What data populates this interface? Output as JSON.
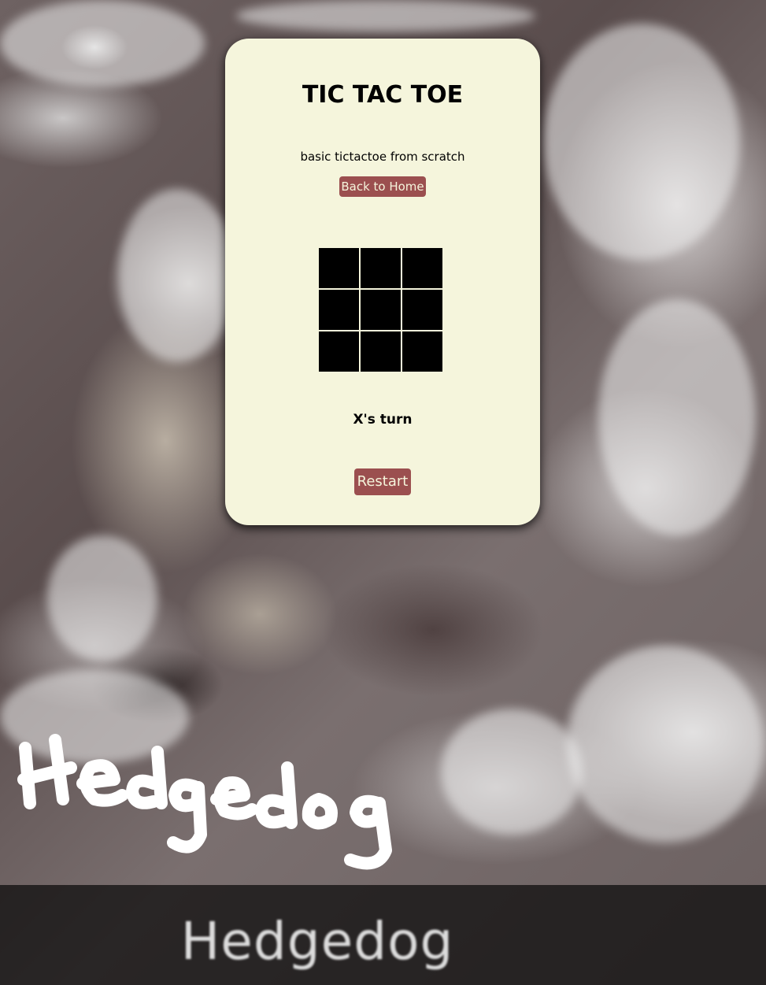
{
  "game": {
    "title": "TIC TAC TOE",
    "subtitle": "basic tictactoe from scratch",
    "home_button_label": "Back to Home",
    "board": [
      "",
      "",
      "",
      "",
      "",
      "",
      "",
      "",
      ""
    ],
    "status": "X's turn",
    "restart_label": "Restart"
  },
  "background": {
    "caption": "Hedgedog",
    "scribble_text": "Hedgedog"
  },
  "colors": {
    "card_background": "#f5f5dc",
    "button_background": "#9b4f4f",
    "button_text": "#f5f5dc",
    "cell_background": "#000000"
  }
}
